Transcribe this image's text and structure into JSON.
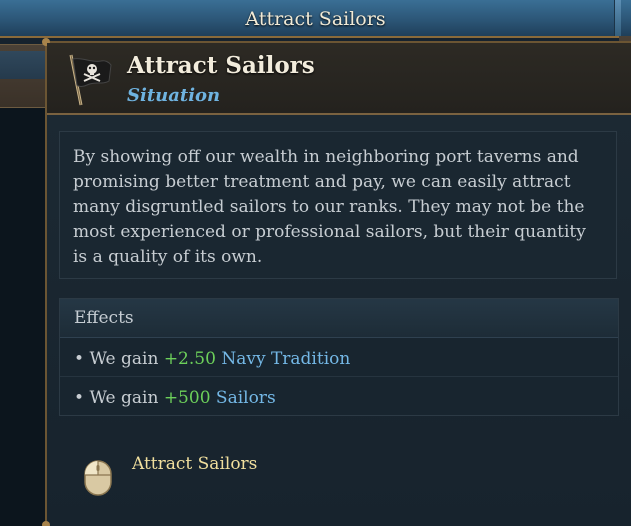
{
  "top_bar": {
    "title": "Attract Sailors"
  },
  "tooltip": {
    "icon": "pirate-flag-icon",
    "title": "Attract Sailors",
    "subtitle": "Situation",
    "description": "By showing off our wealth in neighboring port taverns and promising better treatment and pay, we can easily attract many disgruntled sailors to our ranks. They may not be the most experienced or professional sailors, but their quantity is a quality of its own.",
    "effects": {
      "heading": "Effects",
      "items": [
        {
          "bullet": "•",
          "prefix": "We gain",
          "value": "+2.50",
          "target": "Navy Tradition"
        },
        {
          "bullet": "•",
          "prefix": "We gain",
          "value": "+500",
          "target": "Sailors"
        }
      ]
    },
    "action": {
      "icon": "mouse-left-click-icon",
      "label": "Attract Sailors"
    }
  },
  "colors": {
    "positive_value": "#6ccf5a",
    "link_text": "#74b8e6",
    "subtitle": "#6fb3e0",
    "action_label": "#f0df9e",
    "frame_gold": "#6b5533"
  }
}
